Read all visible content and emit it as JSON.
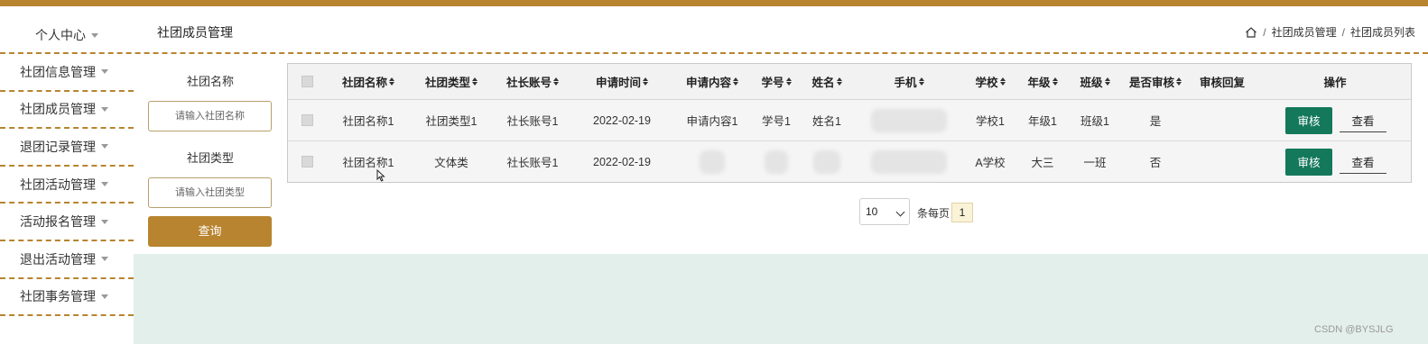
{
  "header": {
    "user_menu": "个人中心",
    "page_title": "社团成员管理",
    "breadcrumb": [
      "社团成员管理",
      "社团成员列表"
    ]
  },
  "sidebar": {
    "items": [
      "社团信息管理",
      "社团成员管理",
      "退团记录管理",
      "社团活动管理",
      "活动报名管理",
      "退出活动管理",
      "社团事务管理"
    ]
  },
  "search": {
    "name_label": "社团名称",
    "name_placeholder": "请输入社团名称",
    "type_label": "社团类型",
    "type_placeholder": "请输入社团类型",
    "query_button": "查询"
  },
  "table": {
    "columns": [
      "社团名称",
      "社团类型",
      "社长账号",
      "申请时间",
      "申请内容",
      "学号",
      "姓名",
      "手机",
      "学校",
      "年级",
      "班级",
      "是否审核",
      "审核回复",
      "操作"
    ],
    "rows": [
      {
        "club_name": "社团名称1",
        "club_type": "社团类型1",
        "leader": "社长账号1",
        "time": "2022-02-19",
        "content": "申请内容1",
        "student_id": "学号1",
        "name": "姓名1",
        "phone": "",
        "school": "学校1",
        "grade": "年级1",
        "class": "班级1",
        "audited": "是",
        "reply": ""
      },
      {
        "club_name": "社团名称1",
        "club_type": "文体类",
        "leader": "社长账号1",
        "time": "2022-02-19",
        "content": "",
        "student_id": "",
        "name": "",
        "phone": "",
        "school": "A学校",
        "grade": "大三",
        "class": "一班",
        "audited": "否",
        "reply": ""
      }
    ],
    "audit_button": "审核",
    "view_button": "查看"
  },
  "pagination": {
    "page_size": "10",
    "per_page_label": "条每页",
    "current_page": "1"
  },
  "watermark": "CSDN @BYSJLG",
  "colors": {
    "accent": "#b8842f",
    "audit_button": "#14785a",
    "bottom_fill": "#e3efea"
  }
}
